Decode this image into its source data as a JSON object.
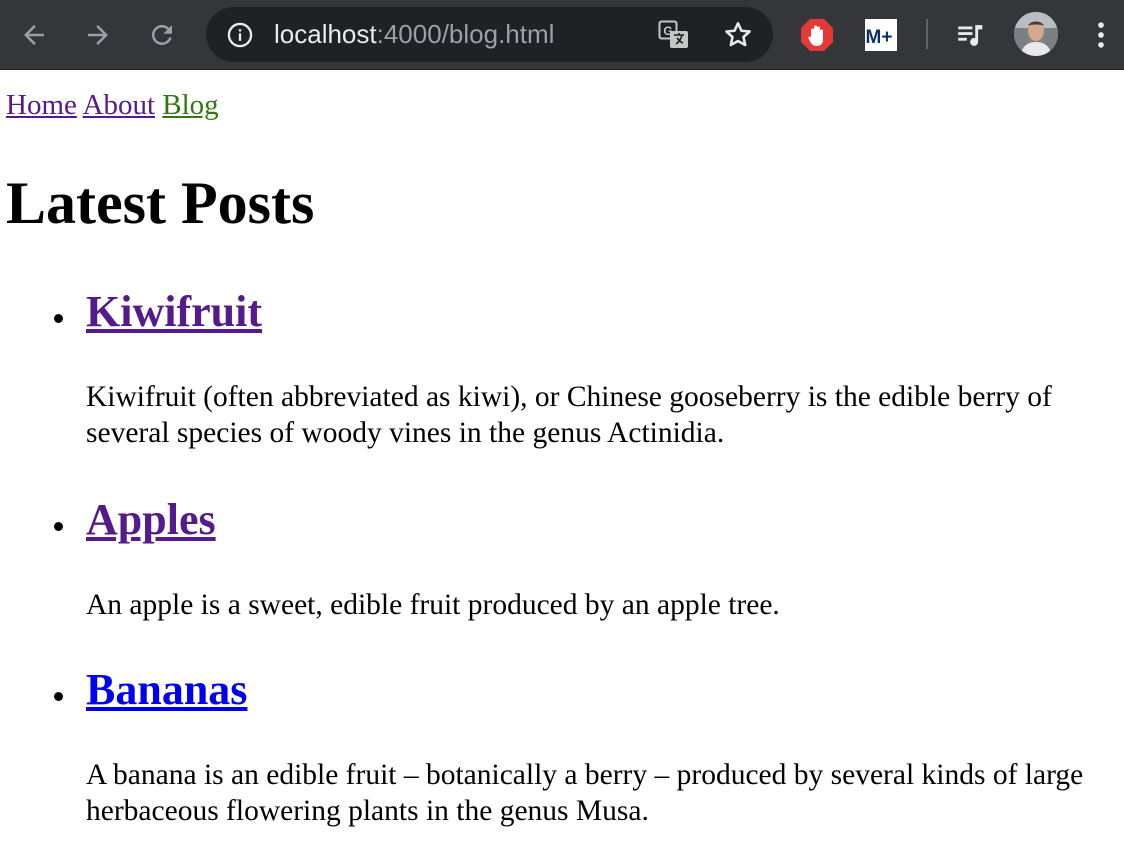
{
  "browser": {
    "url_host": "localhost",
    "url_path": ":4000/blog.html",
    "nav_buttons": [
      "back-icon",
      "forward-icon",
      "reload-icon"
    ],
    "omnibox_icons": [
      "info-icon",
      "translate-icon",
      "bookmark-star-icon"
    ],
    "extensions": [
      "adblock-icon",
      "movistar-plus-icon",
      "media-control-icon",
      "profile-avatar",
      "menu-kebab-icon"
    ],
    "ext_movistar_label": "M+"
  },
  "nav": {
    "links": [
      {
        "label": "Home",
        "state": "visited"
      },
      {
        "label": "About",
        "state": "visited"
      },
      {
        "label": "Blog",
        "state": "current"
      }
    ]
  },
  "page": {
    "title": "Latest Posts"
  },
  "posts": [
    {
      "title": "Kiwifruit",
      "state": "visited",
      "excerpt": "Kiwifruit (often abbreviated as kiwi), or Chinese gooseberry is the edible berry of several species of woody vines in the genus Actinidia."
    },
    {
      "title": "Apples",
      "state": "visited",
      "excerpt": "An apple is a sweet, edible fruit produced by an apple tree."
    },
    {
      "title": "Bananas",
      "state": "unvisited",
      "excerpt": "A banana is an edible fruit – botanically a berry – produced by several kinds of large herbaceous flowering plants in the genus Musa."
    }
  ],
  "colors": {
    "toolbar_bg": "#35363a",
    "omnibox_bg": "#202124",
    "link_visited": "#551a8b",
    "link_unvisited": "#0000ee",
    "link_current": "#317811",
    "adblock_red": "#e53935"
  }
}
